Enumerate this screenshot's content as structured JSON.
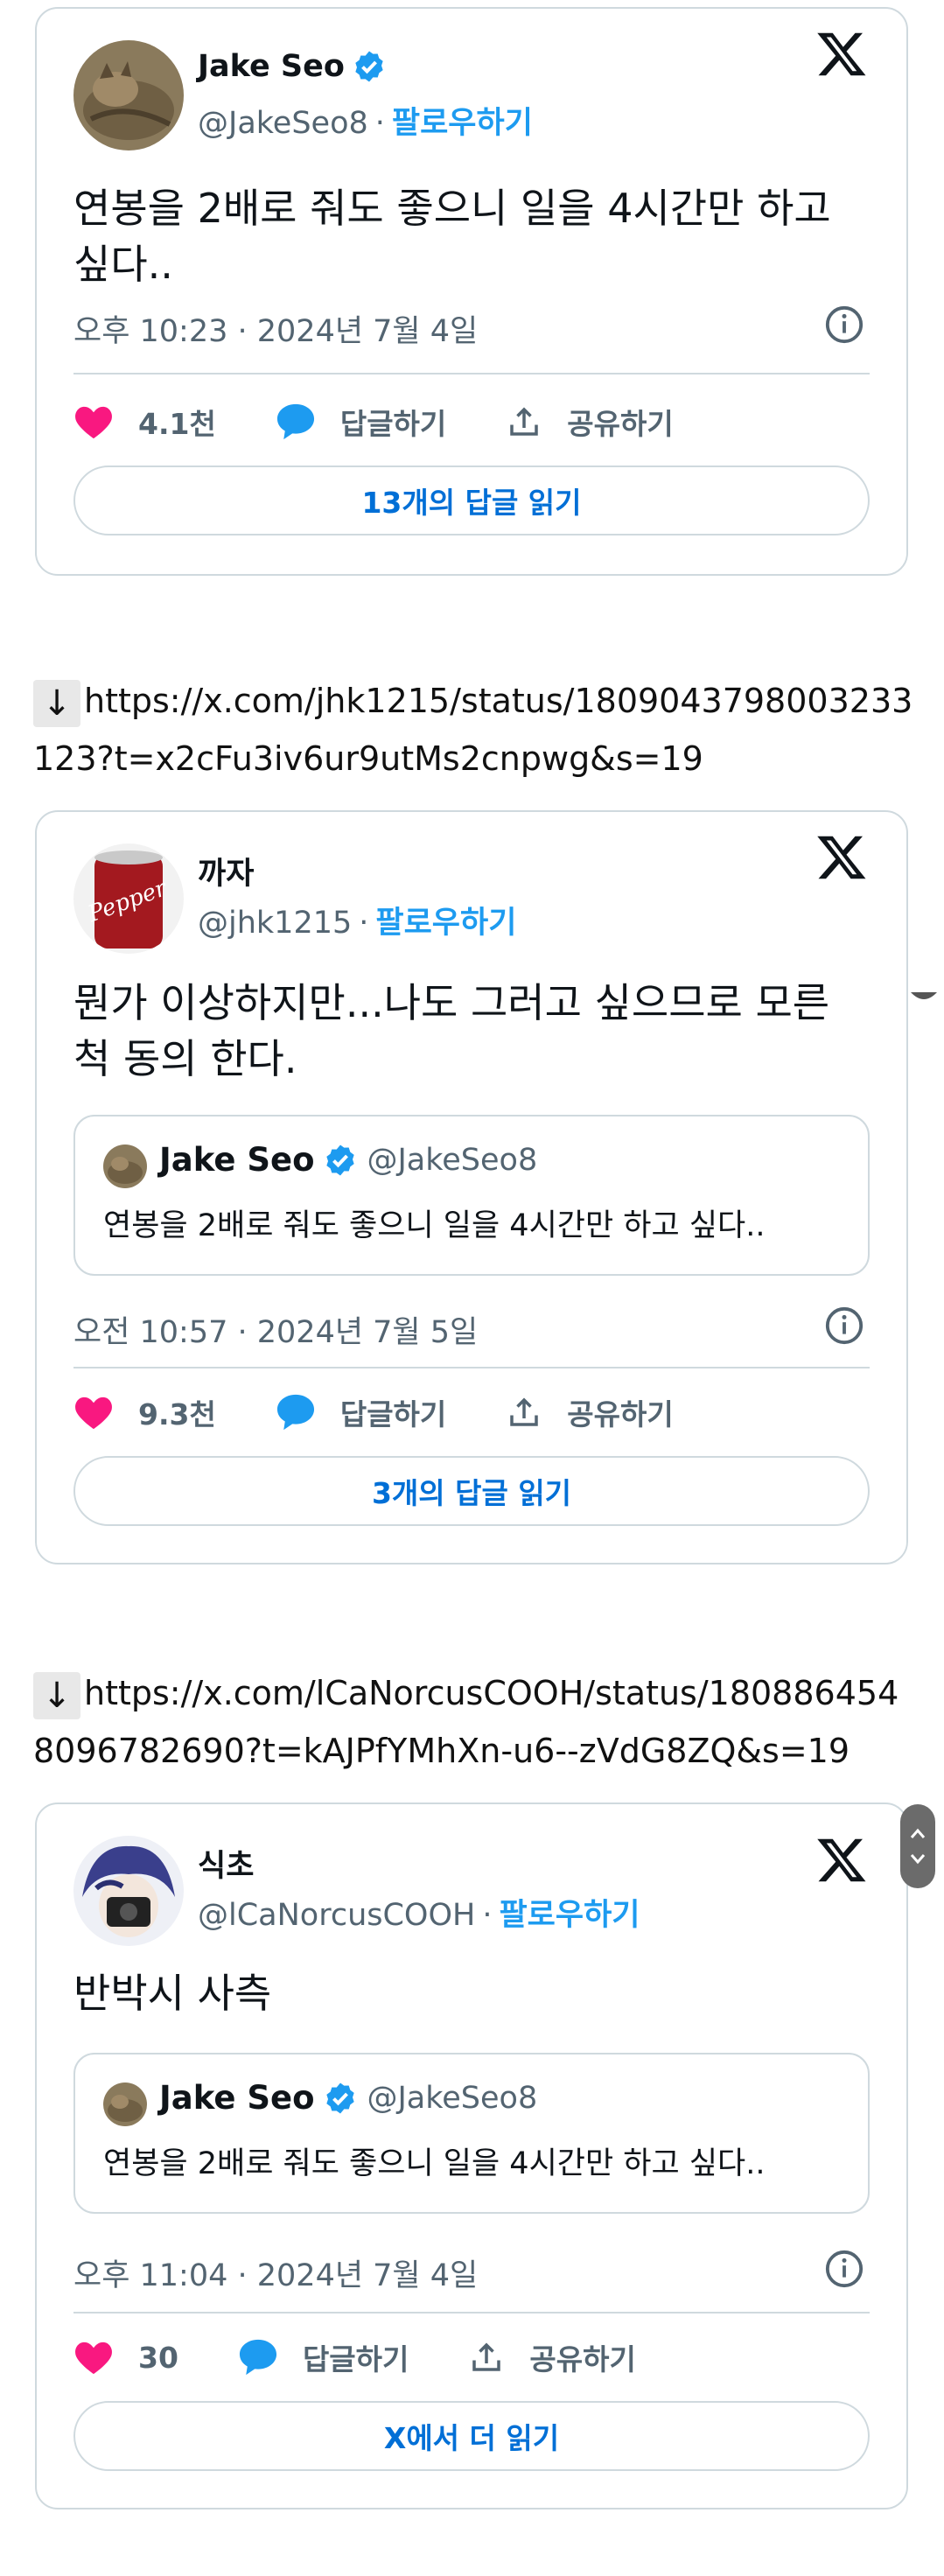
{
  "tweets": [
    {
      "name": "Jake Seo",
      "handle": "@JakeSeo8",
      "follow": "팔로우하기",
      "text": "연봉을 2배로 줘도 좋으니 일을 4시간만 하고 싶다..",
      "time": "오후 10:23 · 2024년 7월 4일",
      "likes": "4.1천",
      "reply": "답글하기",
      "share": "공유하기",
      "read_more": "13개의 답글 읽기"
    },
    {
      "link": "https://x.com/jhk1215/status/1809043798003233123?t=x2cFu3iv6ur9utMs2cnpwg&s=19",
      "name": "까자",
      "handle": "@jhk1215",
      "follow": "팔로우하기",
      "text": "뭔가 이상하지만...나도 그러고 싶으므로 모른 척 동의 한다.",
      "quote": {
        "name": "Jake Seo",
        "handle": "@JakeSeo8",
        "text": "연봉을 2배로 줘도 좋으니 일을 4시간만 하고 싶다.."
      },
      "time": "오전 10:57 · 2024년 7월 5일",
      "likes": "9.3천",
      "reply": "답글하기",
      "share": "공유하기",
      "read_more": "3개의 답글 읽기"
    },
    {
      "link": "https://x.com/lCaNorcusCOOH/status/1808864548096782690?t=kAJPfYMhXn-u6--zVdG8ZQ&s=19",
      "name": "식초",
      "handle": "@lCaNorcusCOOH",
      "follow": "팔로우하기",
      "text": "반박시 사측",
      "quote": {
        "name": "Jake Seo",
        "handle": "@JakeSeo8",
        "text": "연봉을 2배로 줘도 좋으니 일을 4시간만 하고 싶다.."
      },
      "time": "오후 11:04 · 2024년 7월 4일",
      "likes": "30",
      "reply": "답글하기",
      "share": "공유하기",
      "read_more": "X에서 더 읽기"
    }
  ],
  "colors": {
    "like": "#f91880",
    "reply": "#1d9bf0",
    "verified": "#1d9bf0",
    "link": "#006fd6"
  }
}
